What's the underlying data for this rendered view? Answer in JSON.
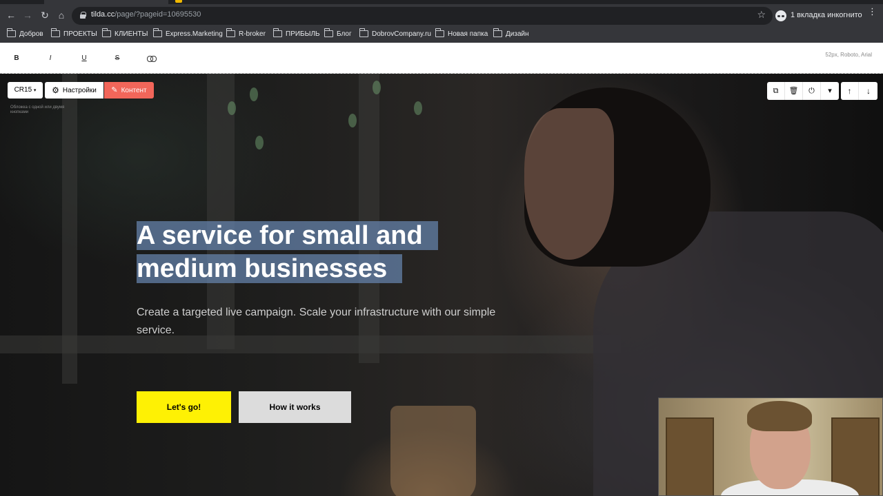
{
  "browser": {
    "url_host": "tilda.cc",
    "url_path": "/page/?pageid=10695530",
    "incognito_label": "1 вкладка инкогнито",
    "nav_icons": [
      "back-arrow-icon",
      "forward-arrow-icon",
      "reload-icon",
      "home-icon",
      "lock-icon",
      "star-icon"
    ],
    "nav_glyphs": {
      "back": "←",
      "forward": "→",
      "reload": "↻",
      "home": "⌂",
      "star": "☆",
      "menu": "⋮"
    }
  },
  "bookmarks": [
    {
      "label": "Добров"
    },
    {
      "label": "ПРОЕКТЫ"
    },
    {
      "label": "КЛИЕНТЫ"
    },
    {
      "label": "Express.Marketing"
    },
    {
      "label": "R-broker"
    },
    {
      "label": "ПРИБЫЛЬ"
    },
    {
      "label": "Блог"
    },
    {
      "label": "DobrovCompany.ru"
    },
    {
      "label": "Новая папка"
    },
    {
      "label": "Дизайн"
    }
  ],
  "editor": {
    "format_buttons": {
      "bold": "B",
      "italic": "I",
      "underline": "U",
      "strike": "S"
    },
    "font_info": "52px, Roboto, Arial",
    "block_id": "CR15",
    "settings_label": "Настройки",
    "content_label": "Контент",
    "block_description": "Обложка с одной или двумя кнопками",
    "tool_glyphs": {
      "duplicate": "⧉",
      "delete": "🗑",
      "power": "⏻",
      "more": "▾",
      "up": "↑",
      "down": "↓",
      "gear": "⚙",
      "pencil": "✎",
      "caret": "▾"
    }
  },
  "hero": {
    "title": "A service for small and medium businesses",
    "subtitle": "Create a targeted live campaign. Scale your infrastructure with our simple service.",
    "primary_button": "Let's go!",
    "secondary_button": "How it works",
    "colors": {
      "primary_button": "#fef104",
      "secondary_button": "#dcdcdc",
      "selection": "#6482aa",
      "content_button": "#f2665a"
    }
  }
}
